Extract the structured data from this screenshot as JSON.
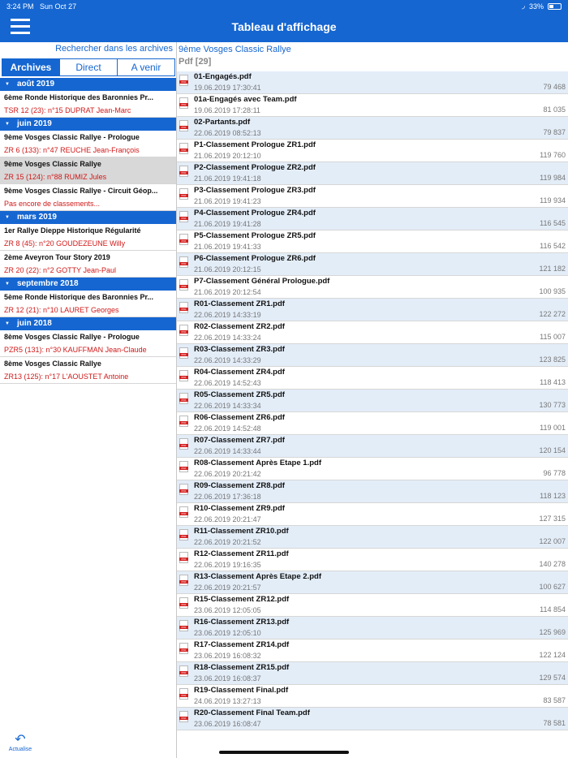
{
  "status": {
    "time": "3:24 PM",
    "date": "Sun Oct 27",
    "battery": "33%"
  },
  "header": {
    "title": "Tableau d'affichage"
  },
  "left": {
    "search_link": "Rechercher dans les archives",
    "tabs": [
      {
        "label": "Archives",
        "active": true
      },
      {
        "label": "Direct",
        "active": false
      },
      {
        "label": "A venir",
        "active": false
      }
    ],
    "groups": [
      {
        "month": "août 2019",
        "events": [
          {
            "name": "6ème Ronde Historique des Baronnies Pr...",
            "sub": "TSR 12 (23): n°15 DUPRAT Jean-Marc"
          }
        ]
      },
      {
        "month": "juin 2019",
        "events": [
          {
            "name": "9ème Vosges Classic Rallye - Prologue",
            "sub": "ZR 6 (133): n°47 REUCHE Jean-François"
          },
          {
            "name": "9ème Vosges Classic Rallye",
            "sub": "ZR 15 (124): n°88 RUMIZ Jules",
            "selected": true
          },
          {
            "name": "9ème Vosges Classic Rallye - Circuit Géop...",
            "sub": "Pas encore de classements..."
          }
        ]
      },
      {
        "month": "mars 2019",
        "events": [
          {
            "name": "1er Rallye Dieppe Historique Régularité",
            "sub": "ZR 8 (45): n°20 GOUDEZEUNE Willy"
          },
          {
            "name": "2ème Aveyron Tour Story 2019",
            "sub": "ZR 20 (22): n°2 GOTTY Jean-Paul"
          }
        ]
      },
      {
        "month": "septembre 2018",
        "events": [
          {
            "name": "5ème Ronde Historique des Baronnies Pr...",
            "sub": "ZR 12 (21): n°10 LAURET Georges"
          }
        ]
      },
      {
        "month": "juin 2018",
        "events": [
          {
            "name": "8ème Vosges Classic Rallye - Prologue",
            "sub": "PZR5 (131): n°30 KAUFFMAN Jean-Claude"
          },
          {
            "name": "8ème Vosges Classic Rallye",
            "sub": "ZR13 (125): n°17 L'AOUSTET Antoine"
          }
        ]
      }
    ],
    "refresh_label": "Actualise"
  },
  "right": {
    "event_title": "9ème Vosges Classic Rallye",
    "section": "Pdf [29]",
    "files": [
      {
        "name": "01-Engagés.pdf",
        "date": "19.06.2019 17:30:41",
        "size": "79 468"
      },
      {
        "name": "01a-Engagés avec Team.pdf",
        "date": "19.06.2019 17:28:11",
        "size": "81 035"
      },
      {
        "name": "02-Partants.pdf",
        "date": "22.06.2019 08:52:13",
        "size": "79 837"
      },
      {
        "name": "P1-Classement Prologue ZR1.pdf",
        "date": "21.06.2019 20:12:10",
        "size": "119 760"
      },
      {
        "name": "P2-Classement Prologue ZR2.pdf",
        "date": "21.06.2019 19:41:18",
        "size": "119 984"
      },
      {
        "name": "P3-Classement Prologue ZR3.pdf",
        "date": "21.06.2019 19:41:23",
        "size": "119 934"
      },
      {
        "name": "P4-Classement Prologue ZR4.pdf",
        "date": "21.06.2019 19:41:28",
        "size": "116 545"
      },
      {
        "name": "P5-Classement Prologue ZR5.pdf",
        "date": "21.06.2019 19:41:33",
        "size": "116 542"
      },
      {
        "name": "P6-Classement Prologue ZR6.pdf",
        "date": "21.06.2019 20:12:15",
        "size": "121 182"
      },
      {
        "name": "P7-Classement Général Prologue.pdf",
        "date": "21.06.2019 20:12:54",
        "size": "100 935"
      },
      {
        "name": "R01-Classement ZR1.pdf",
        "date": "22.06.2019 14:33:19",
        "size": "122 272"
      },
      {
        "name": "R02-Classement ZR2.pdf",
        "date": "22.06.2019 14:33:24",
        "size": "115 007"
      },
      {
        "name": "R03-Classement ZR3.pdf",
        "date": "22.06.2019 14:33:29",
        "size": "123 825"
      },
      {
        "name": "R04-Classement ZR4.pdf",
        "date": "22.06.2019 14:52:43",
        "size": "118 413"
      },
      {
        "name": "R05-Classement ZR5.pdf",
        "date": "22.06.2019 14:33:34",
        "size": "130 773"
      },
      {
        "name": "R06-Classement ZR6.pdf",
        "date": "22.06.2019 14:52:48",
        "size": "119 001"
      },
      {
        "name": "R07-Classement ZR7.pdf",
        "date": "22.06.2019 14:33:44",
        "size": "120 154"
      },
      {
        "name": "R08-Classement Après Etape 1.pdf",
        "date": "22.06.2019 20:21:42",
        "size": "96 778"
      },
      {
        "name": "R09-Classement ZR8.pdf",
        "date": "22.06.2019 17:36:18",
        "size": "118 123"
      },
      {
        "name": "R10-Classement ZR9.pdf",
        "date": "22.06.2019 20:21:47",
        "size": "127 315"
      },
      {
        "name": "R11-Classement ZR10.pdf",
        "date": "22.06.2019 20:21:52",
        "size": "122 007"
      },
      {
        "name": "R12-Classement ZR11.pdf",
        "date": "22.06.2019 19:16:35",
        "size": "140 278"
      },
      {
        "name": "R13-Classement Après Etape 2.pdf",
        "date": "22.06.2019 20:21:57",
        "size": "100 627"
      },
      {
        "name": "R15-Classement ZR12.pdf",
        "date": "23.06.2019 12:05:05",
        "size": "114 854"
      },
      {
        "name": "R16-Classement ZR13.pdf",
        "date": "23.06.2019 12:05:10",
        "size": "125 969"
      },
      {
        "name": "R17-Classement ZR14.pdf",
        "date": "23.06.2019 16:08:32",
        "size": "122 124"
      },
      {
        "name": "R18-Classement ZR15.pdf",
        "date": "23.06.2019 16:08:37",
        "size": "129 574"
      },
      {
        "name": "R19-Classement Final.pdf",
        "date": "24.06.2019 13:27:13",
        "size": "83 587"
      },
      {
        "name": "R20-Classement Final Team.pdf",
        "date": "23.06.2019 16:08:47",
        "size": "78 581"
      }
    ]
  },
  "colors": {
    "accent": "#1566d1",
    "red_text": "#d01818",
    "row_alt": "#e3edf8",
    "selected": "#d8d8d8"
  },
  "icons": {
    "menu": "hamburger-icon",
    "wifi": "wifi-icon",
    "battery": "battery-icon",
    "refresh": "refresh-icon",
    "file": "pdf-icon",
    "month": "triangle-down-icon"
  }
}
